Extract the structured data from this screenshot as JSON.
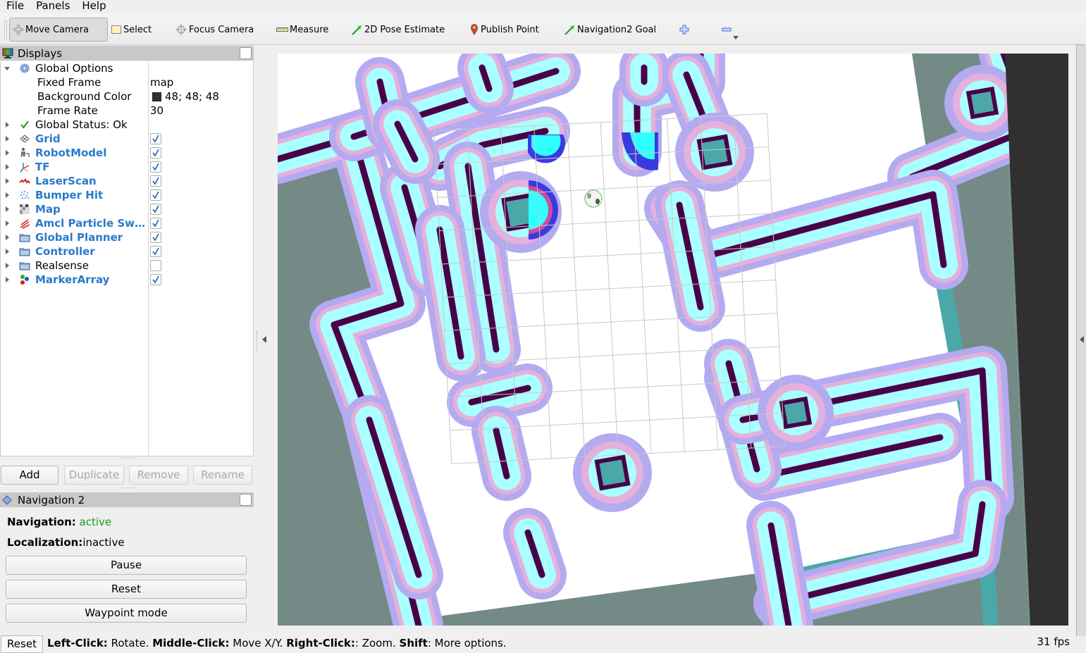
{
  "menu": {
    "items": [
      {
        "label": "File",
        "accel": "F"
      },
      {
        "label": "Panels",
        "accel": "P"
      },
      {
        "label": "Help",
        "accel": "H"
      }
    ]
  },
  "toolbar": {
    "tools": [
      {
        "label": "Move Camera",
        "icon": "move-camera-icon",
        "active": true
      },
      {
        "label": "Select",
        "icon": "select-icon",
        "active": false
      },
      {
        "label": "Focus Camera",
        "icon": "focus-camera-icon",
        "active": false
      },
      {
        "label": "Measure",
        "icon": "measure-icon",
        "active": false
      },
      {
        "label": "2D Pose Estimate",
        "icon": "pose-arrow-icon",
        "active": false
      },
      {
        "label": "Publish Point",
        "icon": "map-pin-icon",
        "active": false
      },
      {
        "label": "Navigation2 Goal",
        "icon": "goal-arrow-icon",
        "active": false
      }
    ],
    "add_tool_icon": "plus-icon",
    "remove_tool_icon": "minus-icon"
  },
  "displays": {
    "title": "Displays",
    "global_options": {
      "label": "Global Options",
      "fixed_frame": {
        "label": "Fixed Frame",
        "value": "map"
      },
      "background_color": {
        "label": "Background Color",
        "value": "48; 48; 48",
        "swatch": "#303030"
      },
      "frame_rate": {
        "label": "Frame Rate",
        "value": "30"
      }
    },
    "global_status": "Global Status: Ok",
    "items": [
      {
        "label": "Grid",
        "enabled": true,
        "icon": "grid-icon"
      },
      {
        "label": "RobotModel",
        "enabled": true,
        "icon": "robot-model-icon"
      },
      {
        "label": "TF",
        "enabled": true,
        "icon": "tf-axes-icon"
      },
      {
        "label": "LaserScan",
        "enabled": true,
        "icon": "laserscan-icon"
      },
      {
        "label": "Bumper Hit",
        "enabled": true,
        "icon": "point-cloud-icon"
      },
      {
        "label": "Map",
        "enabled": true,
        "icon": "map-icon"
      },
      {
        "label": "Amcl Particle Sw…",
        "enabled": true,
        "icon": "particle-swarm-icon"
      },
      {
        "label": "Global Planner",
        "enabled": true,
        "icon": "folder-icon"
      },
      {
        "label": "Controller",
        "enabled": true,
        "icon": "folder-icon"
      },
      {
        "label": "Realsense",
        "enabled": false,
        "icon": "folder-icon"
      },
      {
        "label": "MarkerArray",
        "enabled": true,
        "icon": "marker-array-icon"
      }
    ],
    "buttons": {
      "add": "Add",
      "duplicate": "Duplicate",
      "remove": "Remove",
      "rename": "Rename"
    }
  },
  "nav2": {
    "title": "Navigation 2",
    "navigation_label": "Navigation:",
    "navigation_value": "active",
    "localization_label": "Localization:",
    "localization_value": "inactive",
    "buttons": {
      "pause": "Pause",
      "reset": "Reset",
      "waypoint": "Waypoint mode"
    },
    "active_color": "#1a9a1a"
  },
  "map_colors": {
    "background": "#303030",
    "unknown": "#738a86",
    "free": "#ffffff",
    "lethal": "#4a0048",
    "inscribed": "#aaffff",
    "inflation_near": "#e6b0dc",
    "inflation_far": "#b4aaf0",
    "unknown_edge": "#4aa8a8",
    "grid_line": "#c8c8c8"
  },
  "status_bar": {
    "reset": "Reset",
    "hint_parts": [
      {
        "text": "Left-Click:",
        "bold": true
      },
      {
        "text": " Rotate. ",
        "bold": false
      },
      {
        "text": "Middle-Click:",
        "bold": true
      },
      {
        "text": " Move X/Y. ",
        "bold": false
      },
      {
        "text": "Right-Click:",
        "bold": true
      },
      {
        "text": ": Zoom. ",
        "bold": false
      },
      {
        "text": "Shift",
        "bold": true
      },
      {
        "text": ": More options.",
        "bold": false
      }
    ],
    "fps": "31 fps"
  }
}
